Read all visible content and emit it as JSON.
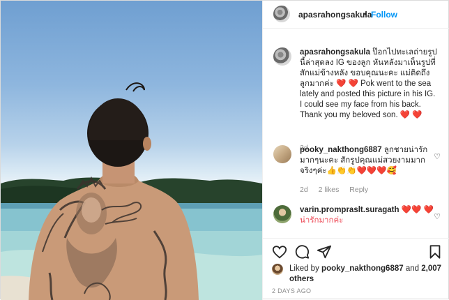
{
  "header": {
    "username": "apasrahongsakula",
    "separator": "•",
    "follow_label": "Follow",
    "more_label": "•••"
  },
  "caption": {
    "username": "apasrahongsakula",
    "text_th": "ป๊อกไปทะเลถ่ายรูปนี้ล่าสุดลง IG ของลูก หันหลังมาเห็นรูปที่สักแม่ข้างหลัง ขอบคุณนะคะ แม่ติดถึงลูกมากค่ะ",
    "hearts": "❤️ ❤️",
    "text_en": "Pok went to the sea lately and posted this picture in his IG. I could see my face from his back. Thank you my beloved son.",
    "hearts_end": "❤️ ❤️",
    "age": "2d"
  },
  "comments": [
    {
      "username": "pooky_nakthong6887",
      "text": "ลูกชายน่ารักมากๆนะคะ สักรูปคุณแม่สวยงามมากจริงๆค่ะ👍👏👏❤️❤️❤️🥰",
      "age": "2d",
      "likes": "2 likes",
      "reply": "Reply"
    },
    {
      "username": "varin.prompraslt.suragath",
      "text": "❤️❤️ ❤️น่ารักมากค่ะ"
    }
  ],
  "actions": {
    "liked_by_prefix": "Liked by",
    "liked_by_user": "pooky_nakthong6887",
    "liked_by_and": "and",
    "liked_by_count": "2,007 others",
    "timestamp": "2 DAYS AGO"
  }
}
